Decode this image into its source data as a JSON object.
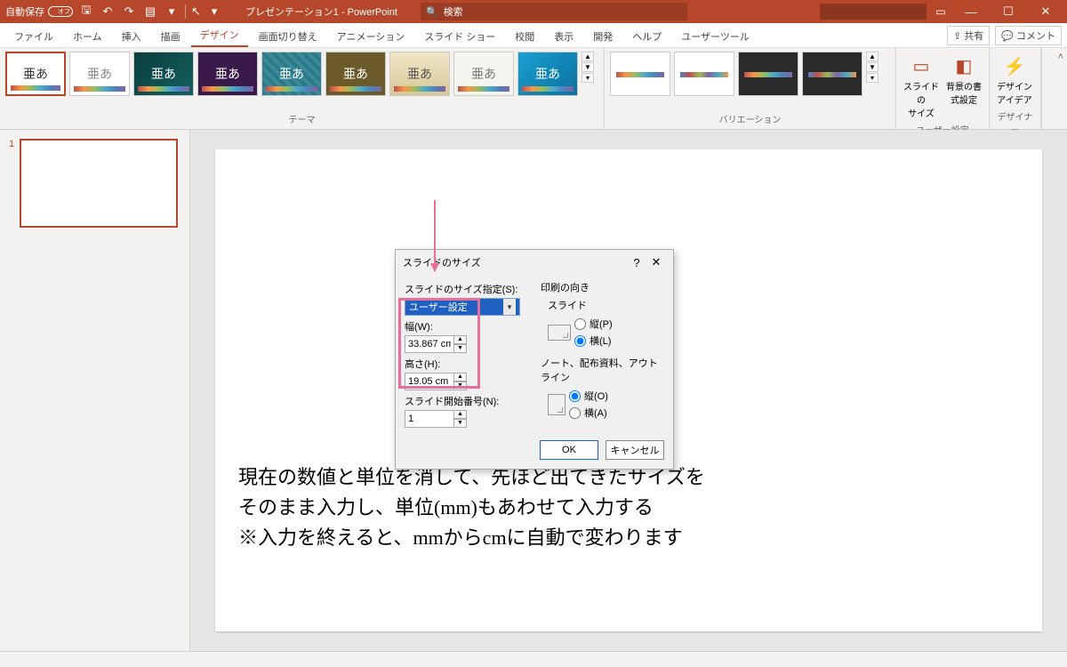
{
  "titlebar": {
    "autosave_label": "自動保存",
    "autosave_state": "オフ",
    "title": "プレゼンテーション1 - PowerPoint",
    "search_placeholder": "検索"
  },
  "tabs": {
    "file": "ファイル",
    "home": "ホーム",
    "insert": "挿入",
    "draw": "描画",
    "design": "デザイン",
    "transitions": "画面切り替え",
    "animations": "アニメーション",
    "slideshow": "スライド ショー",
    "review": "校閲",
    "view": "表示",
    "developer": "開発",
    "help": "ヘルプ",
    "usertools": "ユーザーツール",
    "share": "共有",
    "comments": "コメント"
  },
  "ribbon": {
    "themes_label": "テーマ",
    "variants_label": "バリエーション",
    "user_settings_label": "ユーザー設定",
    "designer_label": "デザイナー",
    "slide_size": "スライドの\nサイズ",
    "format_bg": "背景の書\n式設定",
    "design_ideas": "デザイン\nアイデア",
    "theme_sample": "亜あ"
  },
  "slidepanel": {
    "num1": "1"
  },
  "dialog": {
    "title": "スライドのサイズ",
    "size_spec_label": "スライドのサイズ指定(S):",
    "size_spec_value": "ユーザー設定",
    "width_label": "幅(W):",
    "width_value": "33.867 cm",
    "height_label": "高さ(H):",
    "height_value": "19.05 cm",
    "start_num_label": "スライド開始番号(N):",
    "start_num_value": "1",
    "orientation_label": "印刷の向き",
    "slide_group": "スライド",
    "portrait_p": "縦(P)",
    "landscape_l": "横(L)",
    "notes_group": "ノート、配布資料、アウトライン",
    "portrait_o": "縦(O)",
    "landscape_a": "横(A)",
    "ok": "OK",
    "cancel": "キャンセル"
  },
  "instructions": {
    "line1": "現在の数値と単位を消して、先ほど出てきたサイズを",
    "line2": "そのまま入力し、単位(mm)もあわせて入力する",
    "line3": "※入力を終えると、mmからcmに自動で変わります"
  }
}
